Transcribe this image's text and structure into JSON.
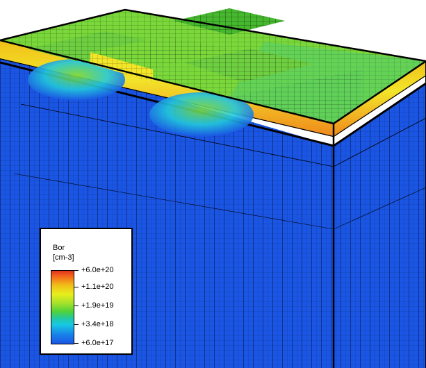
{
  "legend": {
    "title": "Bor",
    "unit": "[cm-3]",
    "ticks": [
      "+6.0e+20",
      "+1.1e+20",
      "+1.9e+19",
      "+3.4e+18",
      "+6.0e+17"
    ]
  },
  "colors": {
    "bulk": "#1a55e4",
    "mesh": "#000000",
    "surface_green": "#7ad83a",
    "implant_yellow": "#f2e52a",
    "implant_orange": "#f08a1c",
    "diffusion_cyan": "#22c8dc"
  }
}
